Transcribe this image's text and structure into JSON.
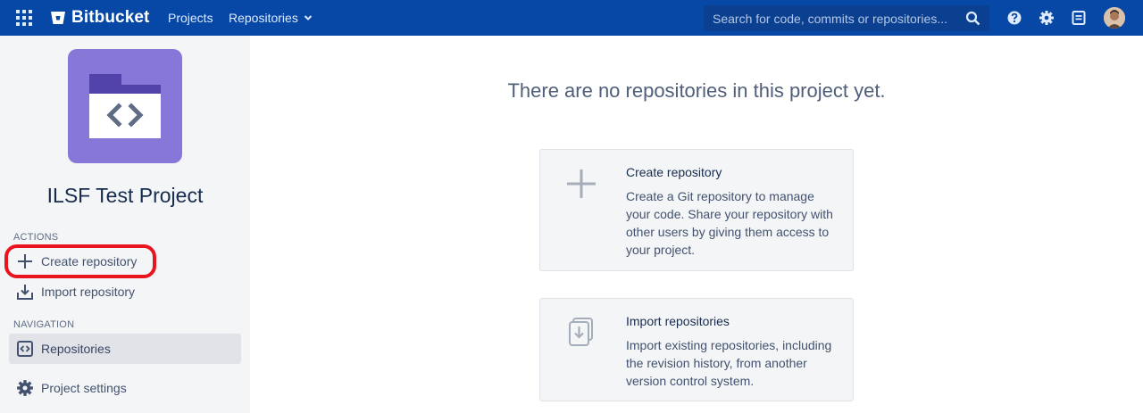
{
  "app": {
    "brand": "Bitbucket",
    "accent": "#0747a6"
  },
  "topnav": {
    "projects_label": "Projects",
    "repositories_label": "Repositories",
    "search_placeholder": "Search for code, commits or repositories...",
    "icons": [
      "apps-grid-icon",
      "bitbucket-logo",
      "chevron-down-icon",
      "search-icon",
      "help-icon",
      "gear-icon",
      "notes-icon",
      "avatar"
    ]
  },
  "sidebar": {
    "project_name": "ILSF Test Project",
    "project_avatar_color": "#8777d9",
    "actions_label": "ACTIONS",
    "navigation_label": "NAVIGATION",
    "actions": [
      {
        "label": "Create repository",
        "icon": "plus-icon"
      },
      {
        "label": "Import repository",
        "icon": "import-icon"
      }
    ],
    "navigation": [
      {
        "label": "Repositories",
        "icon": "code-icon",
        "selected": true
      },
      {
        "label": "Project settings",
        "icon": "gear-icon"
      }
    ],
    "highlight_color": "#e8141e"
  },
  "main": {
    "empty_title": "There are no repositories in this project yet.",
    "cards": [
      {
        "title": "Create repository",
        "description": "Create a Git repository to manage your code. Share your repository with other users by giving them access to your project.",
        "icon": "plus-icon"
      },
      {
        "title": "Import repositories",
        "description": "Import existing repositories, including the revision history, from another version control system.",
        "icon": "import-stack-icon"
      }
    ]
  }
}
